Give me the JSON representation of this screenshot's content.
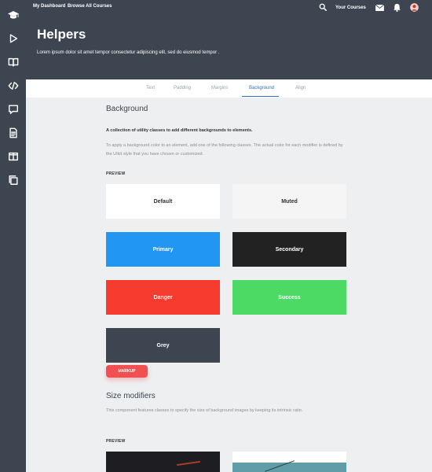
{
  "sidebar": {
    "icons": [
      "graduation-cap-icon",
      "play-icon",
      "book-open-icon",
      "code-icon",
      "chat-icon",
      "document-icon",
      "columns-icon",
      "copy-icon"
    ]
  },
  "topnav": {
    "my_dashboard": "My Dashboard",
    "browse": "Browse All Courses",
    "your_courses": "Your Courses"
  },
  "header": {
    "title": "Helpers",
    "subtitle": "Lorem ipsum dolor sit amet tempor consectetur adipiscing elit, sed do eiusmod tempor ."
  },
  "tabs": [
    {
      "label": "Text"
    },
    {
      "label": "Padding"
    },
    {
      "label": "Margins"
    },
    {
      "label": "Background"
    },
    {
      "label": "Align"
    }
  ],
  "background": {
    "title": "Background",
    "lead": "A collection of utility classes to add different backgrounds to elements.",
    "description": "To apply a background color to an element, add one of the following classes. The actual color for each modifier is defined by the UIkit style that you have chosen or customized.",
    "preview_label": "PREVIEW",
    "swatches": [
      {
        "label": "Default"
      },
      {
        "label": "Muted"
      },
      {
        "label": "Primary"
      },
      {
        "label": "Secondary"
      },
      {
        "label": "Danger"
      },
      {
        "label": "Success"
      },
      {
        "label": "Grey"
      }
    ],
    "markup_button": "MARKUP"
  },
  "size_modifiers": {
    "title": "Size modifiers",
    "description": "This component features classes to specify the size of background images by keeping its intrinsic ratio.",
    "preview_label": "PREVIEW"
  },
  "colors": {
    "dark": "#3d4550",
    "primary": "#2196f3",
    "secondary": "#222222",
    "danger": "#f63b2f",
    "success": "#4cd964",
    "grey": "#3d4550",
    "muted": "#f5f5f5",
    "default": "#ffffff",
    "accent": "#2d6fcb"
  }
}
